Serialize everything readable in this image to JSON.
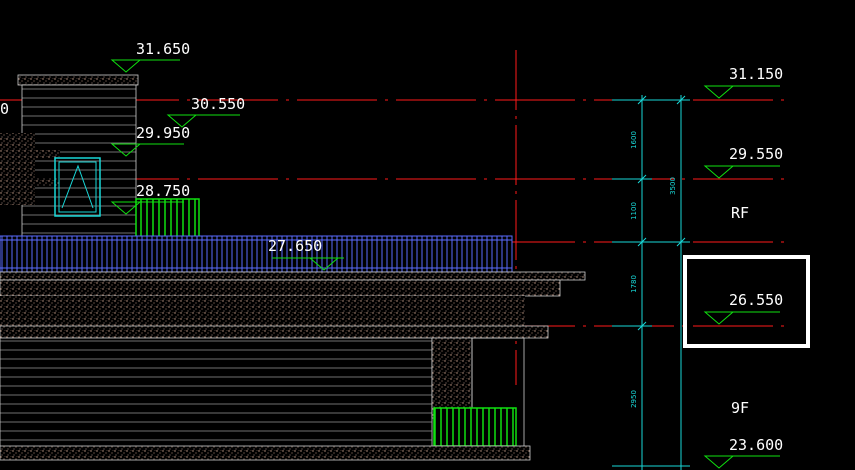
{
  "colors": {
    "background": "#000000",
    "red_line": "#ff1a1a",
    "green": "#10e010",
    "cyan": "#18d8d8",
    "blue": "#5a6cff",
    "white": "#ffffff",
    "hatch": "#b08a78"
  },
  "elevations": {
    "e31650": "31.650",
    "e30550": "30.550",
    "e29950": "29.950",
    "e28750": "28.750",
    "e27650": "27.650",
    "e31150": "31.150",
    "e29550": "29.550",
    "e26550": "26.550",
    "e23600": "23.600"
  },
  "floors": {
    "rf": "RF",
    "f9": "9F"
  },
  "dimensions": {
    "d1600": "1600",
    "d1100": "1100",
    "d1780": "1780",
    "d2950": "2950",
    "d3500": "3500"
  },
  "left_edge_text": "0"
}
